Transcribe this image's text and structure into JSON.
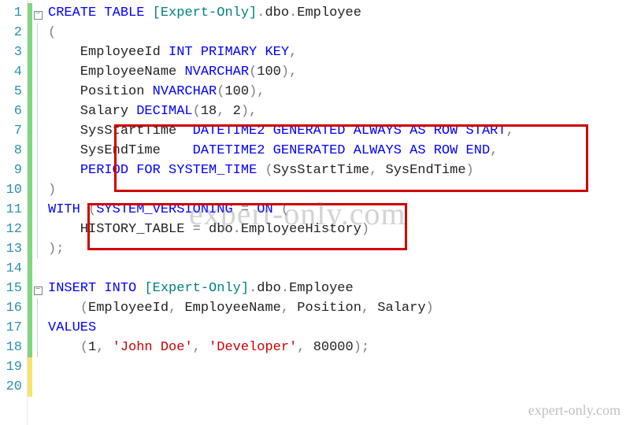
{
  "line_numbers": [
    "1",
    "2",
    "3",
    "4",
    "5",
    "6",
    "7",
    "8",
    "9",
    "10",
    "11",
    "12",
    "13",
    "14",
    "15",
    "16",
    "17",
    "18",
    "19",
    "20"
  ],
  "code": {
    "l1": {
      "a": "CREATE",
      "b": " ",
      "c": "TABLE",
      "d": " ",
      "e": "[Expert-Only]",
      "f": ".",
      "g": "dbo",
      "h": ".",
      "i": "Employee"
    },
    "l2": {
      "a": "("
    },
    "l3": {
      "a": "    EmployeeId ",
      "b": "INT",
      "c": " ",
      "d": "PRIMARY",
      "e": " ",
      "f": "KEY",
      "g": ","
    },
    "l4": {
      "a": "    EmployeeName ",
      "b": "NVARCHAR",
      "c": "(",
      "d": "100",
      "e": ")",
      "f": ","
    },
    "l5": {
      "a": "    Position ",
      "b": "NVARCHAR",
      "c": "(",
      "d": "100",
      "e": ")",
      "f": ","
    },
    "l6": {
      "a": "    Salary ",
      "b": "DECIMAL",
      "c": "(",
      "d": "18",
      "e": ",",
      "f": " ",
      "g": "2",
      "h": ")",
      "i": ","
    },
    "l7": {
      "a": "    SysStartTime  ",
      "b": "DATETIME2",
      "c": " ",
      "d": "GENERATED",
      "e": " ",
      "f": "ALWAYS",
      "g": " ",
      "h": "AS",
      "i": " ",
      "j": "ROW",
      "k": " ",
      "l": "START",
      "m": ","
    },
    "l8": {
      "a": "    SysEndTime    ",
      "b": "DATETIME2",
      "c": " ",
      "d": "GENERATED",
      "e": " ",
      "f": "ALWAYS",
      "g": " ",
      "h": "AS",
      "i": " ",
      "j": "ROW",
      "k": " ",
      "l": "END",
      "m": ","
    },
    "l9": {
      "a": "    ",
      "b": "PERIOD",
      "c": " ",
      "d": "FOR",
      "e": " ",
      "f": "SYSTEM_TIME",
      "g": " ",
      "h": "(",
      "i": "SysStartTime",
      "j": ",",
      "k": " SysEndTime",
      "l": ")"
    },
    "l10": {
      "a": ")"
    },
    "l11": {
      "a": "WITH",
      "b": " ",
      "c": "(",
      "d": "SYSTEM_VERSIONING",
      "e": " ",
      "f": "=",
      "g": " ",
      "h": "ON",
      "i": " ",
      "j": "("
    },
    "l12": {
      "a": "    HISTORY_TABLE ",
      "b": "=",
      "c": " dbo",
      "d": ".",
      "e": "EmployeeHistory",
      "f": ")"
    },
    "l13": {
      "a": ");"
    },
    "l14": {
      "a": ""
    },
    "l15": {
      "a": "INSERT",
      "b": " ",
      "c": "INTO",
      "d": " ",
      "e": "[Expert-Only]",
      "f": ".",
      "g": "dbo",
      "h": ".",
      "i": "Employee"
    },
    "l16": {
      "a": "    ",
      "b": "(",
      "c": "EmployeeId",
      "d": ",",
      "e": " EmployeeName",
      "f": ",",
      "g": " Position",
      "h": ",",
      "i": " Salary",
      "j": ")"
    },
    "l17": {
      "a": "VALUES"
    },
    "l18": {
      "a": "    ",
      "b": "(",
      "c": "1",
      "d": ",",
      "e": " ",
      "f": "'John Doe'",
      "g": ",",
      "h": " ",
      "i": "'Developer'",
      "j": ",",
      "k": " ",
      "l": "80000",
      "m": ")",
      "n": ";"
    }
  },
  "watermark": "expert-only.com",
  "watermark_small": "expert-only.com"
}
